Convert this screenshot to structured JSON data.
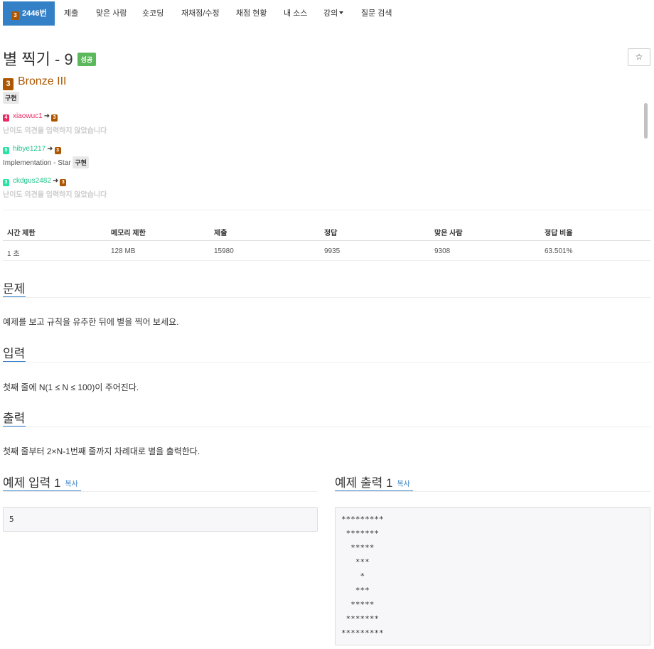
{
  "nav": {
    "problem_tier_badge": "3",
    "problem_number": "2446번",
    "items": [
      "제출",
      "맞은 사람",
      "숏코딩",
      "재채점/수정",
      "채점 현황",
      "내 소스",
      "강의",
      "질문 검색"
    ]
  },
  "problem": {
    "title": "별 찍기 - 9",
    "status_badge": "성공",
    "star_button": "☆",
    "tier_number": "3",
    "tier_name": "Bronze III",
    "tag": "구현"
  },
  "opinions": [
    {
      "level": "4",
      "level_color": "#ec2a63",
      "user": "xiaowuc1",
      "user_color": "#ec2a63",
      "to_tier": "3",
      "note": "난이도 의견을 입력하지 않았습니다",
      "tag": ""
    },
    {
      "level": "5",
      "level_color": "#27e2a4",
      "user": "hibye1217",
      "user_color": "#1fc48c",
      "to_tier": "3",
      "note": "Implementation - Star",
      "tag": "구현"
    },
    {
      "level": "3",
      "level_color": "#27e2a4",
      "user": "ckdgus2482",
      "user_color": "#1fc48c",
      "to_tier": "3",
      "note": "난이도 의견을 입력하지 않았습니다",
      "tag": ""
    }
  ],
  "stats": {
    "headers": [
      "시간 제한",
      "메모리 제한",
      "제출",
      "정답",
      "맞은 사람",
      "정답 비율"
    ],
    "values": [
      "1 초",
      "128 MB",
      "15980",
      "9935",
      "9308",
      "63.501%"
    ]
  },
  "sections": {
    "problem_heading": "문제",
    "problem_text": "예제를 보고 규칙을 유추한 뒤에 별을 찍어 보세요.",
    "input_heading": "입력",
    "input_text": "첫째 줄에 N(1 ≤ N ≤ 100)이 주어진다.",
    "output_heading": "출력",
    "output_text": "첫째 줄부터 2×N-1번째 줄까지 차례대로 별을 출력한다."
  },
  "samples": {
    "input_heading": "예제 입력 1",
    "output_heading": "예제 출력 1",
    "copy_label": "복사",
    "input_lines": [
      "5"
    ],
    "output_lines": [
      "*********",
      " *******",
      "  *****",
      "   ***",
      "    *",
      "   ***",
      "  *****",
      " *******",
      "*********"
    ]
  }
}
